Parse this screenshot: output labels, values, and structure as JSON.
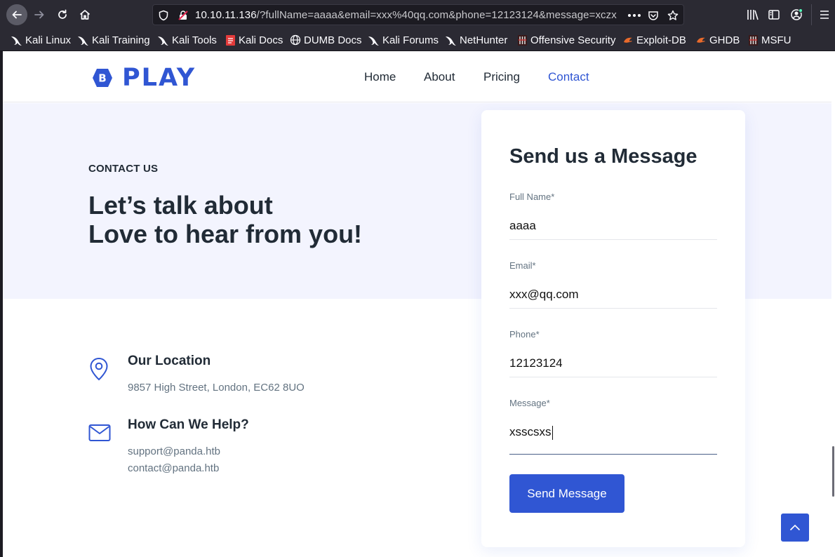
{
  "browser": {
    "url_host": "10.10.11.136",
    "url_rest": "/?fullName=aaaa&email=xxx%40qq.com&phone=12123124&message=xczx",
    "bookmarks": [
      {
        "label": "Kali Linux",
        "icon": "kali-dragon-icon"
      },
      {
        "label": "Kali Training",
        "icon": "kali-dragon-icon"
      },
      {
        "label": "Kali Tools",
        "icon": "kali-dragon-icon"
      },
      {
        "label": "Kali Docs",
        "icon": "kali-docs-icon"
      },
      {
        "label": "DUMB Docs",
        "icon": "globe-icon"
      },
      {
        "label": "Kali Forums",
        "icon": "kali-dragon-icon"
      },
      {
        "label": "NetHunter",
        "icon": "kali-dragon-icon"
      },
      {
        "label": "Offensive Security",
        "icon": "offsec-icon"
      },
      {
        "label": "Exploit-DB",
        "icon": "exploit-db-icon"
      },
      {
        "label": "GHDB",
        "icon": "exploit-db-icon"
      },
      {
        "label": "MSFU",
        "icon": "offsec-icon"
      }
    ]
  },
  "nav": {
    "logo_text": "PLAY",
    "logo_badge": "B",
    "items": [
      {
        "label": "Home",
        "active": false
      },
      {
        "label": "About",
        "active": false
      },
      {
        "label": "Pricing",
        "active": false
      },
      {
        "label": "Contact",
        "active": true
      }
    ]
  },
  "contact": {
    "eyebrow": "CONTACT US",
    "headline_line1": "Let’s talk about",
    "headline_line2": "Love to hear from you!",
    "location_title": "Our Location",
    "location_text": "9857 High Street, London, EC62 8UO",
    "help_title": "How Can We Help?",
    "help_email1": "support@panda.htb",
    "help_email2": "contact@panda.htb"
  },
  "form": {
    "title": "Send us a Message",
    "fullname_label": "Full Name*",
    "fullname_value": "aaaa",
    "email_label": "Email*",
    "email_value": "xxx@qq.com",
    "phone_label": "Phone*",
    "phone_value": "12123124",
    "message_label": "Message*",
    "message_value": "xsscsxs",
    "submit_label": "Send Message"
  },
  "colors": {
    "brand": "#3056d3",
    "heading": "#212b36",
    "muted": "#637381",
    "band": "#f3f4fe"
  }
}
